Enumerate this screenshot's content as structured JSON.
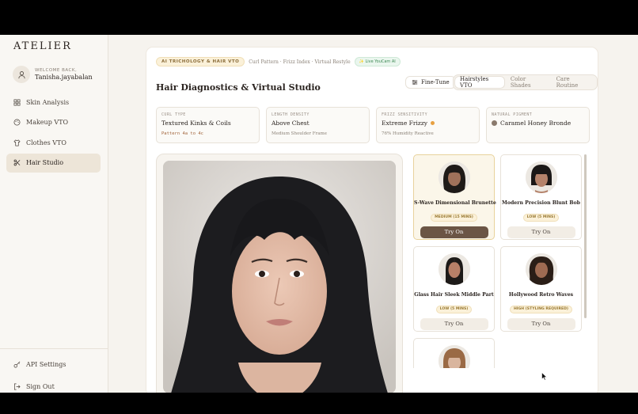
{
  "brand": "ATELIER",
  "user": {
    "welcome": "WELCOME BACK,",
    "name": "Tanisha.jayabalan"
  },
  "nav": [
    {
      "label": "Skin Analysis",
      "icon": "grid-icon"
    },
    {
      "label": "Makeup VTO",
      "icon": "palette-icon"
    },
    {
      "label": "Clothes VTO",
      "icon": "shirt-icon"
    },
    {
      "label": "Hair Studio",
      "icon": "scissors-icon",
      "active": true
    }
  ],
  "sidebar_bottom": {
    "api": "API Settings",
    "signout": "Sign Out"
  },
  "header": {
    "tag": "AI TRICHOLOGY & HAIR VTO",
    "subline": "Curl Pattern · Frizz Index · Virtual Restyle",
    "live": "✨ Live YouCam AI",
    "title": "Hair Diagnostics & Virtual Studio",
    "fine_tune": "Fine-Tune",
    "tabs": [
      "Hairstyles VTO",
      "Color Shades",
      "Care Routine"
    ],
    "active_tab": "Hairstyles VTO"
  },
  "stats": [
    {
      "label": "CURL TYPE",
      "value": "Textured Kinks & Coils",
      "sub": "Pattern 4a to 4c"
    },
    {
      "label": "LENGTH DENSITY",
      "value": "Above Chest",
      "sub": "Medium Shoulder Frame"
    },
    {
      "label": "FRIZZ SENSITIVITY",
      "value": "Extreme Frizzy",
      "sub": "76% Humidity Reactive",
      "dot": "#e7a041"
    },
    {
      "label": "NATURAL PIGMENT",
      "value": "Caramel Honey Bronde",
      "swatch": "#8a7a6d"
    }
  ],
  "styles": [
    {
      "name": "S-Wave Dimensional Brunette",
      "badge": "MEDIUM (15 MINS)",
      "cta": "Try On",
      "selected": true
    },
    {
      "name": "Modern Precision Blunt Bob",
      "badge": "LOW (5 MINS)",
      "cta": "Try On"
    },
    {
      "name": "Glass Hair Sleek Middle Part",
      "badge": "LOW (5 MINS)",
      "cta": "Try On"
    },
    {
      "name": "Hollywood Retro Waves",
      "badge": "HIGH (STYLING REQUIRED)",
      "cta": "Try On"
    }
  ],
  "colors": {
    "accent": "#6b5545",
    "badge_bg": "#fbf1d9",
    "sidebar_active": "#ede5d8"
  }
}
